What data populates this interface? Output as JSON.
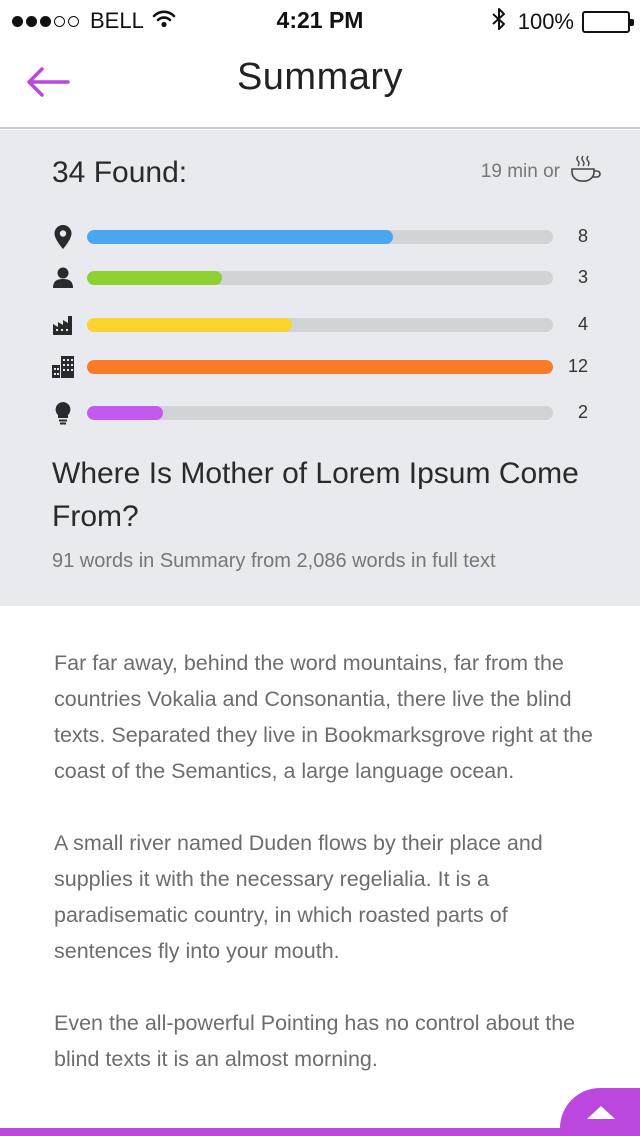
{
  "status_bar": {
    "carrier": "BELL",
    "signal_dots_full": 3,
    "signal_dots_empty": 2,
    "time": "4:21 PM",
    "battery": "100%",
    "icons": [
      "wifi-icon",
      "bluetooth-icon",
      "battery-icon"
    ]
  },
  "nav": {
    "title": "Summary",
    "back_icon": "arrow-left-icon",
    "accent_color": "#bb47df"
  },
  "summary": {
    "found_label": "34 Found:",
    "read_time": "19 min or",
    "read_time_icon": "coffee-cup-icon",
    "stats": [
      {
        "icon": "location-pin-icon",
        "value": 8,
        "fill": 0.657,
        "color": "#4aa6ef"
      },
      {
        "icon": "person-icon",
        "value": 3,
        "fill": 0.29,
        "color": "#8dd130"
      },
      {
        "icon": "factory-icon",
        "value": 4,
        "fill": 0.44,
        "color": "#f8d42c"
      },
      {
        "icon": "buildings-icon",
        "value": 12,
        "fill": 1.0,
        "color": "#fb7a25"
      },
      {
        "icon": "lightbulb-icon",
        "value": 2,
        "fill": 0.163,
        "color": "#c35af0"
      }
    ],
    "article_title": "Where Is Mother of Lorem Ipsum Come From?",
    "word_count": "91 words in Summary from 2,086 words in full text",
    "panel_color": "#e8eaef"
  },
  "body": {
    "paragraphs": [
      "Far far away, behind the word mountains, far from the countries Vokalia and Consonantia, there live the blind texts. Separated they live in Bookmarksgrove right at the coast of the Semantics, a large language ocean.",
      "A small river named Duden flows by their place and supplies it with the necessary regelialia. It is a paradisematic country, in which roasted parts of sentences fly into your mouth.",
      "Even the all-powerful Pointing has no control about the blind texts it is an almost morning."
    ]
  },
  "fab": {
    "icon": "chevron-up-icon"
  }
}
